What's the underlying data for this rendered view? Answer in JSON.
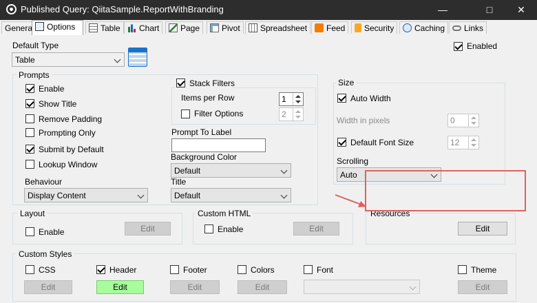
{
  "window": {
    "title": "Published Query: QiitaSample.ReportWithBranding"
  },
  "tabs": [
    "General",
    "Options",
    "Table",
    "Chart",
    "Page",
    "Pivot",
    "Spreadsheet",
    "Feed",
    "Security",
    "Caching",
    "Links"
  ],
  "active_tab": "Options",
  "default_type": {
    "label": "Default Type",
    "value": "Table"
  },
  "enabled": {
    "label": "Enabled",
    "checked": true
  },
  "prompts": {
    "legend": "Prompts",
    "items": [
      {
        "label": "Enable",
        "checked": true
      },
      {
        "label": "Show Title",
        "checked": true
      },
      {
        "label": "Remove Padding",
        "checked": false
      },
      {
        "label": "Prompting Only",
        "checked": false
      },
      {
        "label": "Submit by Default",
        "checked": true
      },
      {
        "label": "Lookup Window",
        "checked": false
      }
    ],
    "behaviour_label": "Behaviour",
    "behaviour_value": "Display Content",
    "stack_filters": {
      "label": "Stack Filters",
      "checked": true
    },
    "items_per_row": {
      "label": "Items per Row",
      "value": "1"
    },
    "filter_options": {
      "label": "Filter Options",
      "checked": false,
      "value": "2"
    },
    "prompt_to_label": {
      "label": "Prompt To Label",
      "value": ""
    },
    "background_color": {
      "label": "Background Color",
      "value": "Default"
    },
    "title": {
      "label": "Title",
      "value": "Default"
    }
  },
  "size": {
    "legend": "Size",
    "auto_width": {
      "label": "Auto Width",
      "checked": true
    },
    "width_in_pixels": {
      "label": "Width in pixels",
      "value": "0"
    },
    "default_font_size": {
      "label": "Default Font Size",
      "checked": true,
      "value": "12"
    },
    "scrolling": {
      "label": "Scrolling",
      "value": "Auto"
    }
  },
  "layout": {
    "legend": "Layout",
    "enable_label": "Enable",
    "edit_label": "Edit"
  },
  "custom_html": {
    "legend": "Custom HTML",
    "enable_label": "Enable",
    "edit_label": "Edit"
  },
  "resources": {
    "legend": "Resources",
    "edit_label": "Edit"
  },
  "custom_styles": {
    "legend": "Custom Styles",
    "items": [
      {
        "label": "CSS",
        "checked": false,
        "edit_label": "Edit"
      },
      {
        "label": "Header",
        "checked": true,
        "edit_label": "Edit"
      },
      {
        "label": "Footer",
        "checked": false,
        "edit_label": "Edit"
      },
      {
        "label": "Colors",
        "checked": false,
        "edit_label": "Edit"
      },
      {
        "label": "Font",
        "checked": false
      },
      {
        "label": "Theme",
        "checked": false,
        "edit_label": "Edit"
      }
    ]
  },
  "colors": {
    "titlebar": "#2d2d2d",
    "highlight": "#e06060",
    "header_edit": "#a6ff9a",
    "tab_icon_blue": "#1e88e5"
  },
  "icons": {
    "app": "circle-app-icon",
    "calendar": "calendar-icon",
    "arrow": "red-arrow-annotation"
  }
}
